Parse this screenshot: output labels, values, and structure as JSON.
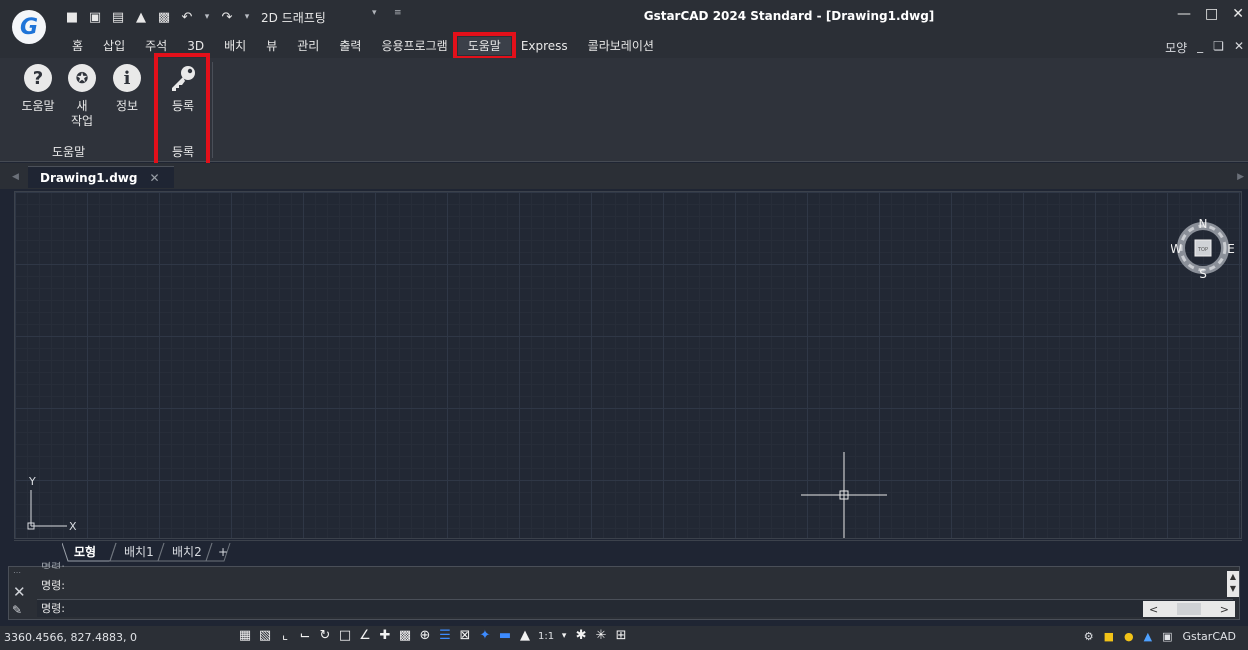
{
  "app": {
    "title": "GstarCAD 2024 Standard - [Drawing1.dwg]",
    "logo_letter": "G",
    "workspace": "2D 드래프팅"
  },
  "quick_access": [
    "new-icon",
    "open-icon",
    "save-icon",
    "saveas-icon",
    "print-icon",
    "undo-icon",
    "redo-icon"
  ],
  "menu": {
    "tabs": [
      "홈",
      "삽입",
      "주석",
      "3D",
      "배치",
      "뷰",
      "관리",
      "출력",
      "응용프로그램",
      "도움말",
      "Express",
      "콜라보레이션"
    ],
    "active": "도움말",
    "right_label": "모양"
  },
  "ribbon": {
    "buttons": [
      {
        "label": "도움말",
        "icon": "help-icon",
        "glyph": "?"
      },
      {
        "label": "새\n작업",
        "icon": "new-task-icon",
        "glyph": "✪"
      },
      {
        "label": "정보",
        "icon": "info-icon",
        "glyph": "i"
      },
      {
        "label": "등록",
        "icon": "key-icon"
      }
    ],
    "groups": [
      "도움말",
      "등록"
    ]
  },
  "document": {
    "tab_label": "Drawing1.dwg"
  },
  "viewcube": {
    "n": "N",
    "s": "S",
    "e": "E",
    "w": "W",
    "center": "TOP"
  },
  "ucs": {
    "x": "X",
    "y": "Y"
  },
  "layout_tabs": [
    "모형",
    "배치1",
    "배치2",
    "+"
  ],
  "command": {
    "lines": [
      "명령:",
      "명령:"
    ],
    "partial_top": "명령:"
  },
  "status": {
    "coordinates": "3360.4566, 827.4883, 0",
    "scale": "1:1",
    "app_name": "GstarCAD"
  },
  "colors": {
    "highlight": "#e3101a",
    "canvas": "#222834",
    "chrome": "#2b2f36"
  }
}
